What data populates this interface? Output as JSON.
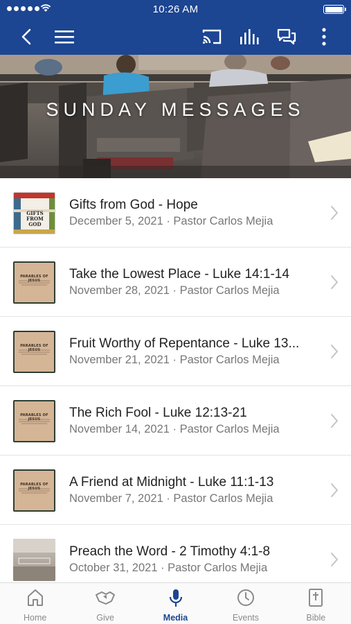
{
  "status_bar": {
    "time": "10:26 AM"
  },
  "nav": {
    "icons": [
      "back-icon",
      "menu-icon",
      "cast-icon",
      "audio-bars-icon",
      "chat-icon",
      "more-vertical-icon"
    ]
  },
  "hero": {
    "title": "SUNDAY MESSAGES"
  },
  "messages": [
    {
      "title": "Gifts from God - Hope",
      "meta": "December 5, 2021 · Pastor Carlos Mejia",
      "thumb_text": "GIFTS FROM GOD"
    },
    {
      "title": "Take the Lowest Place - Luke 14:1-14",
      "meta": "November 28, 2021 · Pastor Carlos Mejia",
      "thumb_text": "PARABLES OF JESUS"
    },
    {
      "title": "Fruit Worthy of Repentance - Luke 13...",
      "meta": "November 21, 2021 · Pastor Carlos Mejia",
      "thumb_text": "PARABLES OF JESUS"
    },
    {
      "title": "The Rich Fool - Luke 12:13-21",
      "meta": "November 14, 2021 · Pastor Carlos Mejia",
      "thumb_text": "PARABLES OF JESUS"
    },
    {
      "title": "A Friend at Midnight - Luke 11:1-13",
      "meta": "November 7, 2021 · Pastor Carlos Mejia",
      "thumb_text": "PARABLES OF JESUS"
    },
    {
      "title": "Preach the Word - 2 Timothy 4:1-8",
      "meta": "October 31, 2021 · Pastor Carlos Mejia",
      "thumb_text": ""
    }
  ],
  "tabs": [
    {
      "label": "Home",
      "icon": "home-icon",
      "active": false
    },
    {
      "label": "Give",
      "icon": "give-icon",
      "active": false
    },
    {
      "label": "Media",
      "icon": "microphone-icon",
      "active": true
    },
    {
      "label": "Events",
      "icon": "clock-icon",
      "active": false
    },
    {
      "label": "Bible",
      "icon": "bible-icon",
      "active": false
    }
  ],
  "colors": {
    "brand": "#1c4592",
    "active_tab": "#1c4592",
    "inactive_tab": "#8a8a8a"
  }
}
